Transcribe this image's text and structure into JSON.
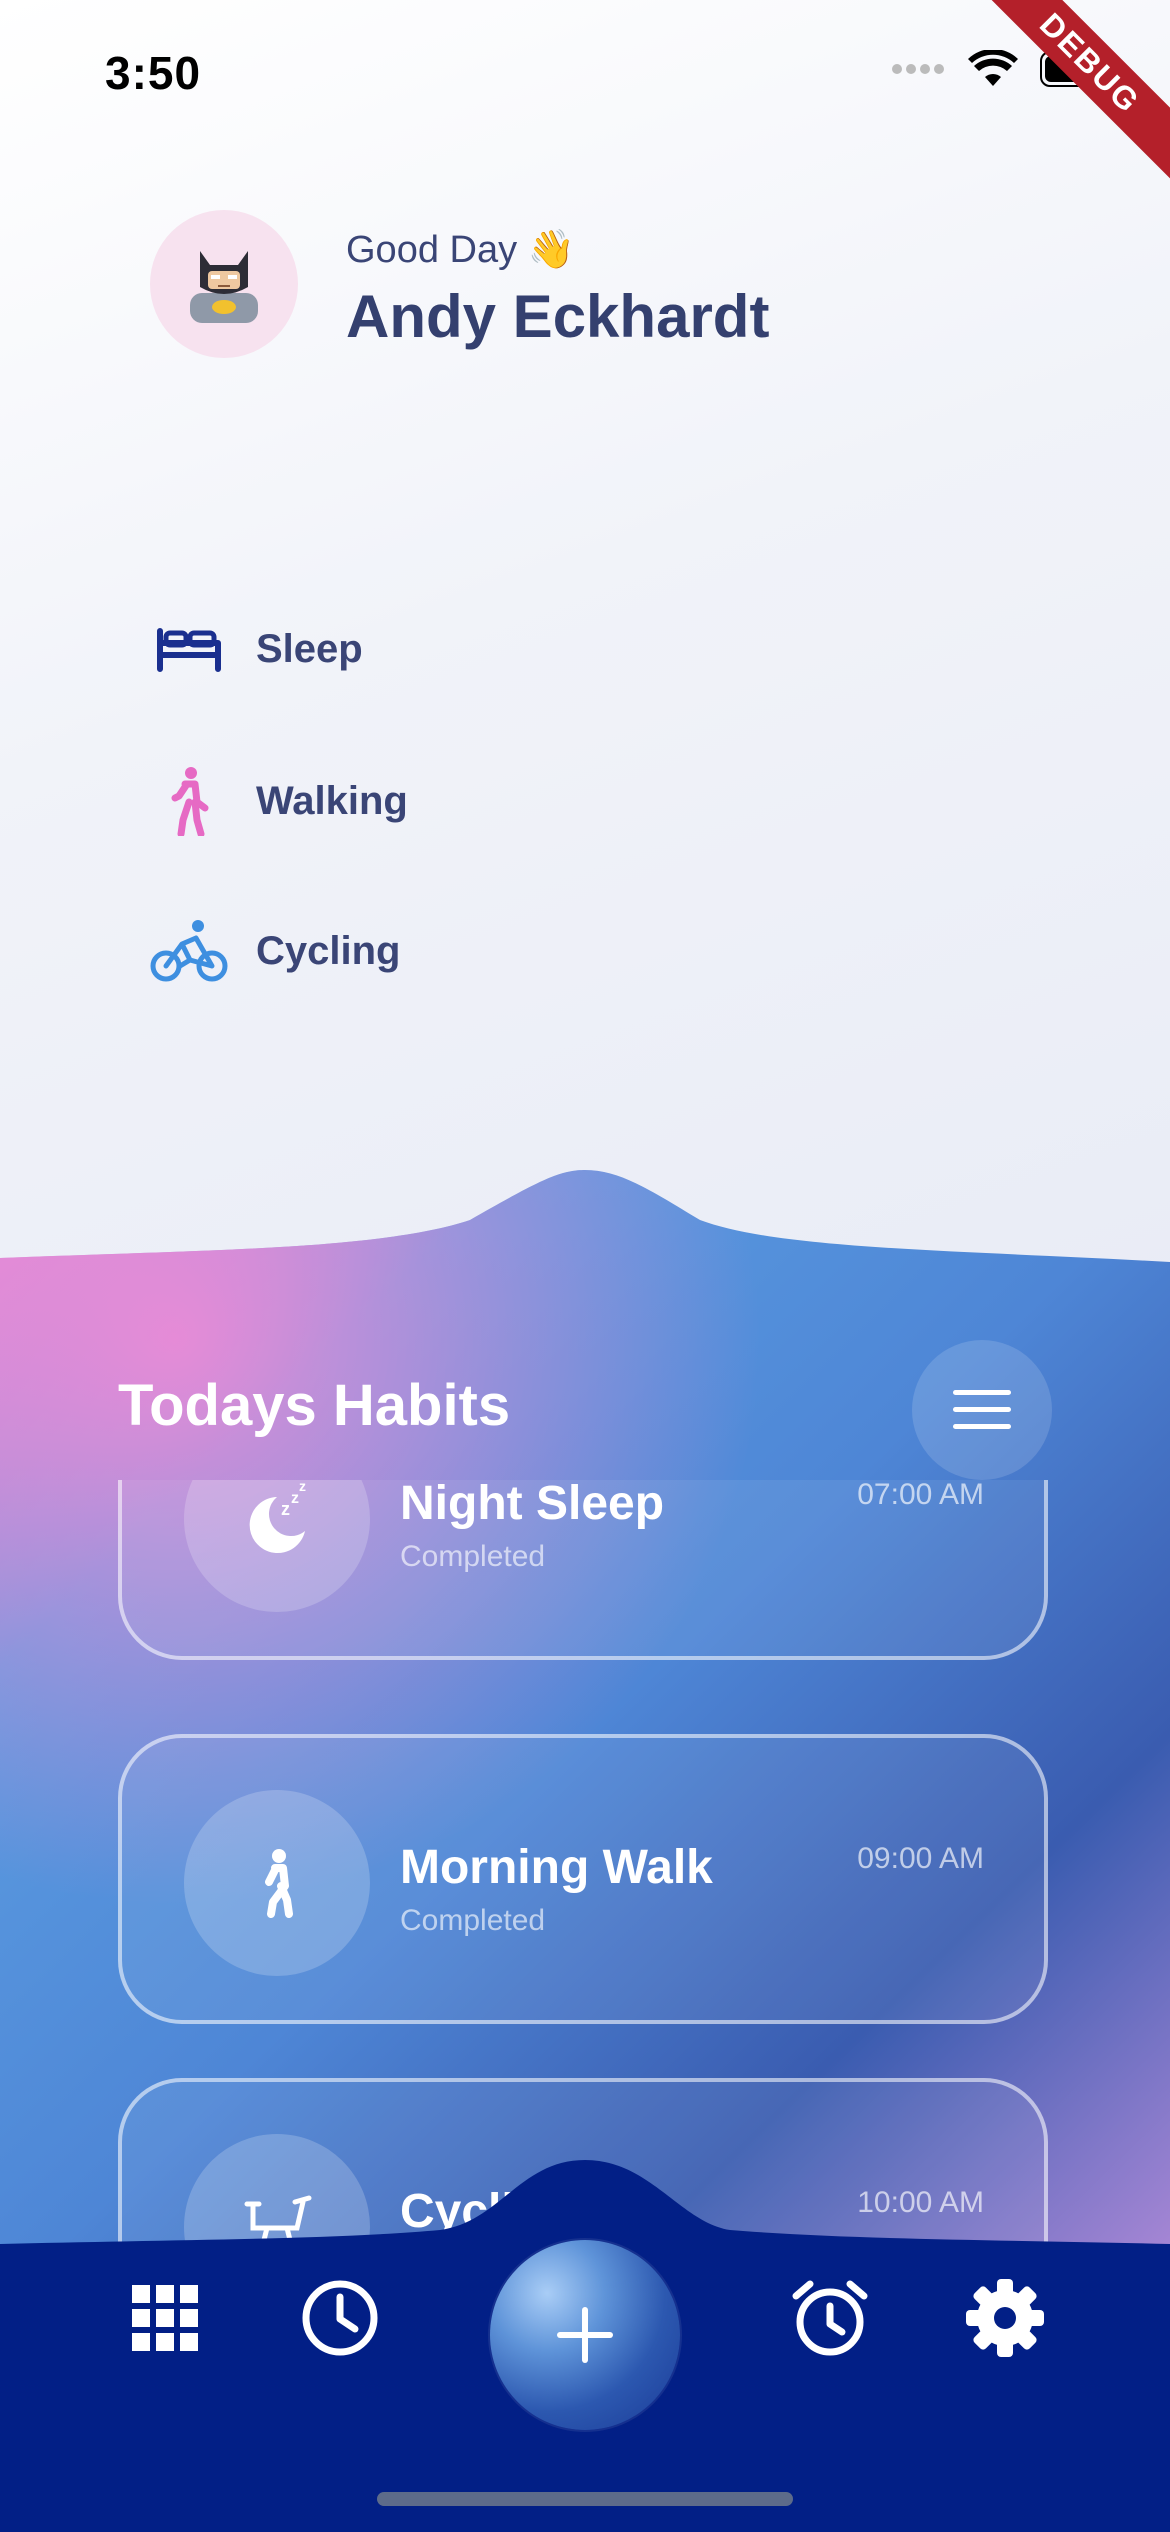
{
  "status_bar": {
    "time": "3:50",
    "debug_label": "DEBUG"
  },
  "profile": {
    "greeting": "Good Day 👋",
    "name": "Andy Eckhardt",
    "avatar_icon": "batman-avatar-icon"
  },
  "activities": [
    {
      "label": "Sleep",
      "icon": "bed-icon",
      "color": "#1a2f8f"
    },
    {
      "label": "Walking",
      "icon": "walking-icon",
      "color": "#e66ac4"
    },
    {
      "label": "Cycling",
      "icon": "bicycle-icon",
      "color": "#3e8fe0"
    }
  ],
  "habits": {
    "title": "Todays Habits",
    "items": [
      {
        "name": "Night Sleep",
        "status": "Completed",
        "time": "07:00 AM",
        "icon": "moon-sleep-icon"
      },
      {
        "name": "Morning Walk",
        "status": "Completed",
        "time": "09:00 AM",
        "icon": "walking-icon"
      },
      {
        "name": "Cycling",
        "status": "",
        "time": "10:00 AM",
        "icon": "stationary-bike-icon"
      }
    ]
  },
  "bottom_nav": {
    "items": [
      "grid-icon",
      "clock-icon",
      "add-icon",
      "alarm-icon",
      "settings-icon"
    ],
    "background": "#021f86"
  },
  "colors": {
    "accent_blue": "#4a90d9",
    "accent_pink": "#e67ad0",
    "text_dark": "#34406f"
  }
}
